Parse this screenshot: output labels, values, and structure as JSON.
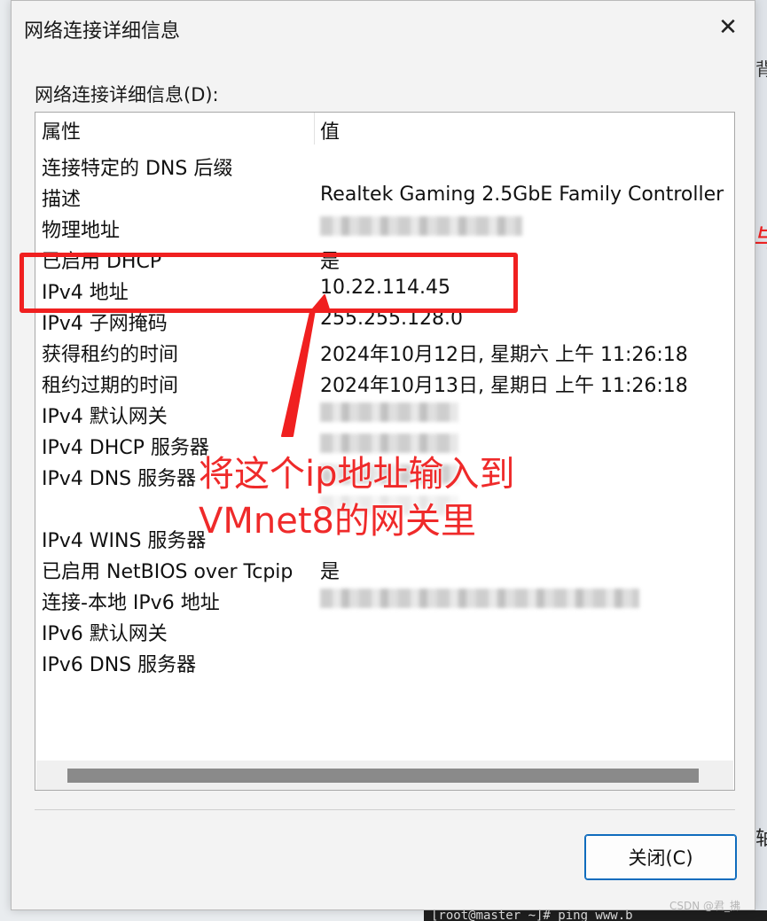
{
  "dialog": {
    "title": "网络连接详细信息",
    "section_label": "网络连接详细信息(D):",
    "close_button_label": "关闭(C)"
  },
  "table": {
    "headers": [
      "属性",
      "值"
    ],
    "rows": [
      {
        "property": "连接特定的 DNS 后缀",
        "value": ""
      },
      {
        "property": "描述",
        "value": "Realtek Gaming 2.5GbE Family Controller"
      },
      {
        "property": "物理地址",
        "value": ""
      },
      {
        "property": "已启用 DHCP",
        "value": "是"
      },
      {
        "property": "IPv4 地址",
        "value": "10.22.114.45"
      },
      {
        "property": "IPv4 子网掩码",
        "value": "255.255.128.0"
      },
      {
        "property": "获得租约的时间",
        "value": "2024年10月12日, 星期六 上午 11:26:18"
      },
      {
        "property": "租约过期的时间",
        "value": "2024年10月13日, 星期日 上午 11:26:18"
      },
      {
        "property": "IPv4 默认网关",
        "value": ""
      },
      {
        "property": "IPv4 DHCP 服务器",
        "value": ""
      },
      {
        "property": "IPv4 DNS 服务器",
        "value": ""
      },
      {
        "property": "",
        "value": ""
      },
      {
        "property": "IPv4 WINS 服务器",
        "value": ""
      },
      {
        "property": "已启用 NetBIOS over Tcpip",
        "value": "是"
      },
      {
        "property": "连接-本地 IPv6 地址",
        "value": ""
      },
      {
        "property": "IPv6 默认网关",
        "value": ""
      },
      {
        "property": "IPv6 DNS 服务器",
        "value": ""
      }
    ]
  },
  "annotation": {
    "line1": "将这个ip地址输入到",
    "line2": "VMnet8的网关里",
    "color": "#ef2a2a"
  },
  "background": {
    "terminal_text": "[root@master ~]# ping www.b",
    "watermark": "CSDN @君_拂"
  },
  "colors": {
    "accent": "#0f6cbd",
    "annotation_red": "#f02020"
  }
}
